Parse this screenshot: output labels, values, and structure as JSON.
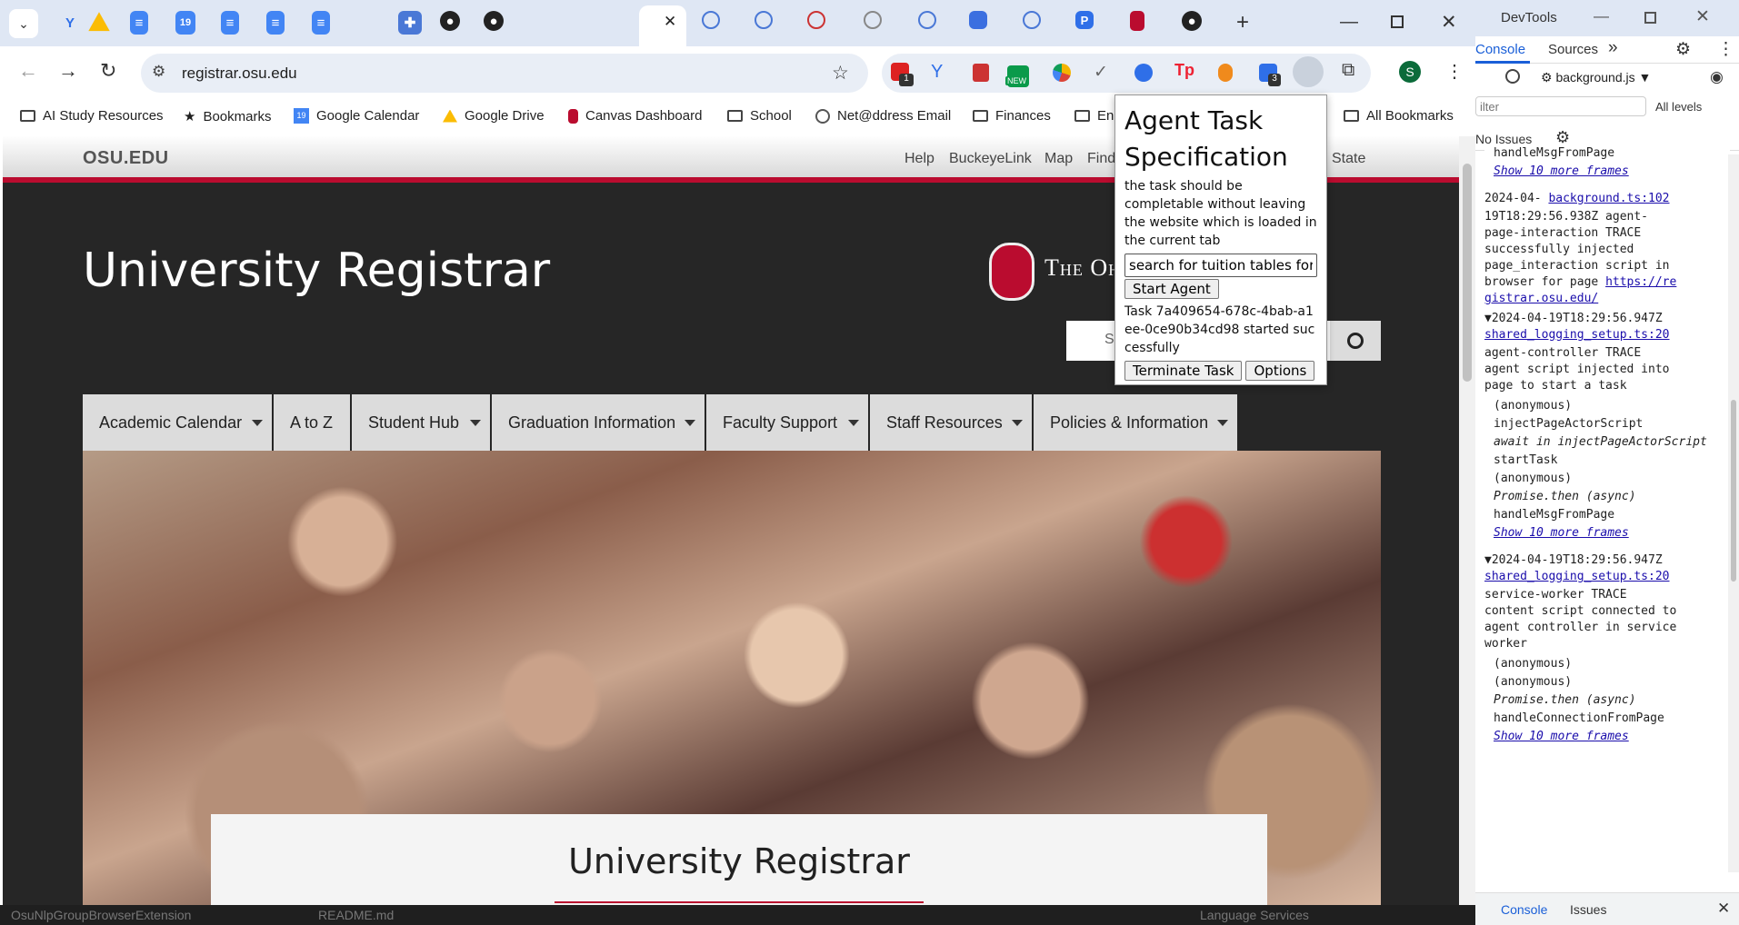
{
  "browser": {
    "address": "registrar.osu.edu",
    "bookmarks": [
      "AI Study Resources",
      "Bookmarks",
      "Google Calendar",
      "Google Drive",
      "Canvas Dashboard",
      "School",
      "Net@ddress Email",
      "Finances",
      "En",
      "All Bookmarks"
    ],
    "ext_badges": {
      "first": "1",
      "second": "NEW",
      "third": "3"
    },
    "profile_initial": "S"
  },
  "site": {
    "osu_logo": "OSU.EDU",
    "top_links": [
      "Help",
      "BuckeyeLink",
      "Map",
      "Find"
    ],
    "top_links_right": [
      "State"
    ],
    "title": "University Registrar",
    "university_wordmark": "The Ohio State University",
    "search_placeholder": "S",
    "nav": [
      "Academic Calendar",
      "A to Z",
      "Student Hub",
      "Graduation Information",
      "Faculty Support",
      "Staff Resources",
      "Policies & Information"
    ],
    "hero_caption": "University Registrar"
  },
  "popup": {
    "title": "Agent Task Specification",
    "hint": "the task should be completable without leaving the website which is loaded in the current tab",
    "task_value": "search for tuition tables for g",
    "start_label": "Start Agent",
    "status": "Task 7a409654-678c-4bab-a1ee-0ce90b34cd98 started successfully",
    "terminate_label": "Terminate Task",
    "options_label": "Options"
  },
  "devtools": {
    "title": "DevTools",
    "tabs": [
      "Console",
      "Sources"
    ],
    "context": "background.js",
    "filter_placeholder": "ilter",
    "levels": "All levels",
    "issues": "No Issues",
    "log": [
      {
        "text": "handleMsgFromPage",
        "kind": "frame"
      },
      {
        "text": "Show 10 more frames",
        "kind": "link"
      },
      {
        "text": "2024-04-",
        "kind": "ts",
        "src": "background.ts:102"
      },
      {
        "text": "19T18:29:56.938Z agent-\npage-interaction TRACE\nsuccessfully injected\npage_interaction script in\nbrowser for page ",
        "kind": "msg",
        "url": "https://re\ngistrar.osu.edu/"
      },
      {
        "text": "▼2024-04-19T18:29:56.947Z",
        "kind": "ts2",
        "src": "shared_logging_setup.ts:20"
      },
      {
        "text": "agent-controller TRACE\nagent script injected into\npage to start a task",
        "kind": "msg"
      },
      {
        "text": "(anonymous)",
        "kind": "frame"
      },
      {
        "text": "injectPageActorScript",
        "kind": "frame"
      },
      {
        "text": "await in injectPageActorScript",
        "kind": "italic"
      },
      {
        "text": "startTask",
        "kind": "frame"
      },
      {
        "text": "(anonymous)",
        "kind": "frame"
      },
      {
        "text": "Promise.then (async)",
        "kind": "italic"
      },
      {
        "text": "handleMsgFromPage",
        "kind": "frame"
      },
      {
        "text": "Show 10 more frames",
        "kind": "link"
      },
      {
        "text": "▼2024-04-19T18:29:56.947Z",
        "kind": "ts2",
        "src": "shared_logging_setup.ts:20"
      },
      {
        "text": "service-worker TRACE\ncontent script connected to\nagent controller in service\nworker",
        "kind": "msg"
      },
      {
        "text": "(anonymous)",
        "kind": "frame"
      },
      {
        "text": "(anonymous)",
        "kind": "frame"
      },
      {
        "text": "Promise.then (async)",
        "kind": "italic"
      },
      {
        "text": "handleConnectionFromPage",
        "kind": "frame"
      },
      {
        "text": "Show 10 more frames",
        "kind": "link"
      }
    ],
    "drawer_tabs": [
      "Console",
      "Issues"
    ]
  },
  "statusbar": {
    "left": "OsuNlpGroupBrowserExtension",
    "file": "README.md",
    "right": "Language Services"
  },
  "colors": {
    "osu_red": "#ba0c2f",
    "nav_gray": "#dcdcdc",
    "page_dark": "#262626"
  }
}
